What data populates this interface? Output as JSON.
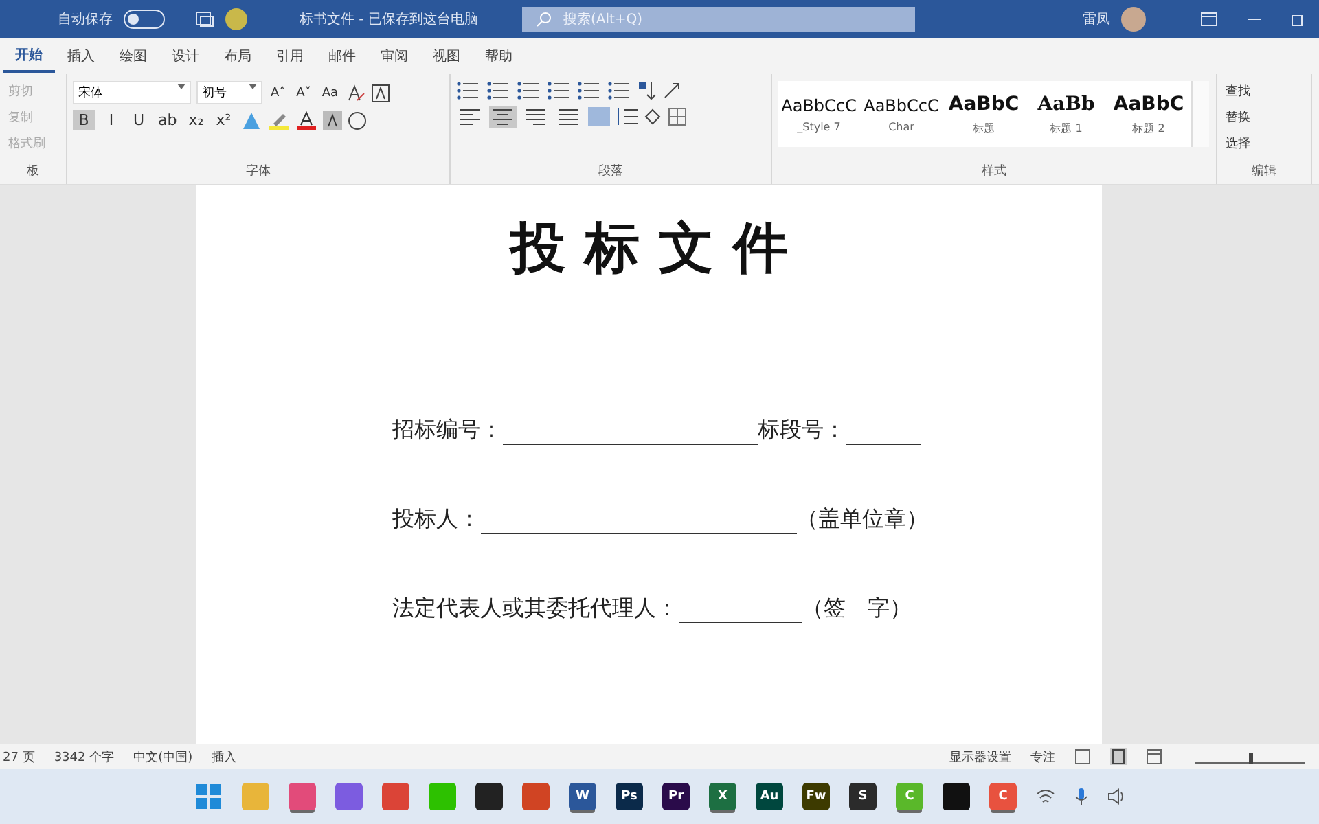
{
  "title_bar": {
    "autosave_label": "自动保存",
    "autosave_on": false,
    "document_title": "标书文件 - 已保存到这台电脑",
    "search": {
      "placeholder": "搜索(Alt+Q)"
    },
    "user_name": "雷凤"
  },
  "tabs": [
    {
      "label": "开始",
      "selected": true
    },
    {
      "label": "插入",
      "selected": false
    },
    {
      "label": "绘图",
      "selected": false
    },
    {
      "label": "设计",
      "selected": false
    },
    {
      "label": "布局",
      "selected": false
    },
    {
      "label": "引用",
      "selected": false
    },
    {
      "label": "邮件",
      "selected": false
    },
    {
      "label": "审阅",
      "selected": false
    },
    {
      "label": "视图",
      "selected": false
    },
    {
      "label": "帮助",
      "selected": false
    }
  ],
  "ribbon": {
    "clipboard": {
      "items": [
        "剪切",
        "复制",
        "格式刷"
      ],
      "label": "板"
    },
    "font": {
      "font_name": "宋体",
      "font_size": "初号",
      "row1": [
        "A˄",
        "A˅",
        "Aa"
      ],
      "row2": [
        {
          "text": "B",
          "selected": true
        },
        {
          "text": "I",
          "selected": false
        },
        {
          "text": "U",
          "selected": false
        },
        {
          "text": "ab",
          "selected": false
        },
        {
          "text": "x₂",
          "selected": false
        },
        {
          "text": "x²",
          "selected": false
        }
      ],
      "label": "字体"
    },
    "paragraph": {
      "alignments": [
        {
          "selected": false
        },
        {
          "selected": true
        },
        {
          "selected": false
        },
        {
          "selected": false
        }
      ],
      "label": "段落"
    },
    "styles": {
      "items": [
        {
          "preview": "AaBbCcC",
          "name": "_Style 7",
          "kind": "normal"
        },
        {
          "preview": "AaBbCcC",
          "name": "Char",
          "kind": "normal"
        },
        {
          "preview": "AaBbC",
          "name": "标题",
          "kind": "heading"
        },
        {
          "preview": "AaBb",
          "name": "标题 1",
          "kind": "serif"
        },
        {
          "preview": "AaBbC",
          "name": "标题 2",
          "kind": "heading"
        }
      ],
      "label": "样式"
    },
    "editing": {
      "items": [
        "查找",
        "替换",
        "选择"
      ],
      "label": "编辑"
    }
  },
  "document": {
    "title": "投 标 文 件",
    "lines": [
      {
        "parts": [
          {
            "kind": "text",
            "text": "招标编号："
          },
          {
            "kind": "blank"
          },
          {
            "kind": "text",
            "text": "标段号："
          },
          {
            "kind": "blank"
          }
        ]
      },
      {
        "parts": [
          {
            "kind": "text",
            "text": "投标人："
          },
          {
            "kind": "blank"
          },
          {
            "kind": "text",
            "text": "（盖单位章）"
          }
        ]
      },
      {
        "parts": [
          {
            "kind": "text",
            "text": "法定代表人或其委托代理人："
          },
          {
            "kind": "blank"
          },
          {
            "kind": "text",
            "text": "（签　字）"
          }
        ]
      }
    ]
  },
  "status_bar": {
    "page": "27 页",
    "words": "3342 个字",
    "language": "中文(中国)",
    "mode": "插入",
    "display_settings": "显示器设置",
    "focus": "专注",
    "zoom": {
      "level": 0.5
    }
  },
  "taskbar": {
    "apps": [
      {
        "color": "#e8b53a",
        "selected": false
      },
      {
        "color": "#e24b7a",
        "selected": true
      },
      {
        "color": "#7c5ce0",
        "selected": false
      },
      {
        "color": "#db4437",
        "selected": false
      },
      {
        "color": "#2dc100",
        "selected": false
      },
      {
        "color": "#222222",
        "selected": false
      },
      {
        "color": "#d04423",
        "selected": false
      },
      {
        "label": "W",
        "color": "#2b579a",
        "selected": true
      },
      {
        "label": "Ps",
        "color": "#0b2a4a",
        "selected": false
      },
      {
        "label": "Pr",
        "color": "#2a0b4a",
        "selected": false
      },
      {
        "label": "X",
        "color": "#1d6f42",
        "selected": true
      },
      {
        "label": "Au",
        "color": "#00473e",
        "selected": false
      },
      {
        "label": "Fw",
        "color": "#3d3a00",
        "selected": false
      },
      {
        "label": "S",
        "color": "#2b2b2b",
        "selected": false
      },
      {
        "label": "C",
        "color": "#5ab82a",
        "selected": true
      },
      {
        "color": "#111111",
        "selected": false
      },
      {
        "label": "C",
        "color": "#e8523f",
        "selected": true
      }
    ]
  }
}
